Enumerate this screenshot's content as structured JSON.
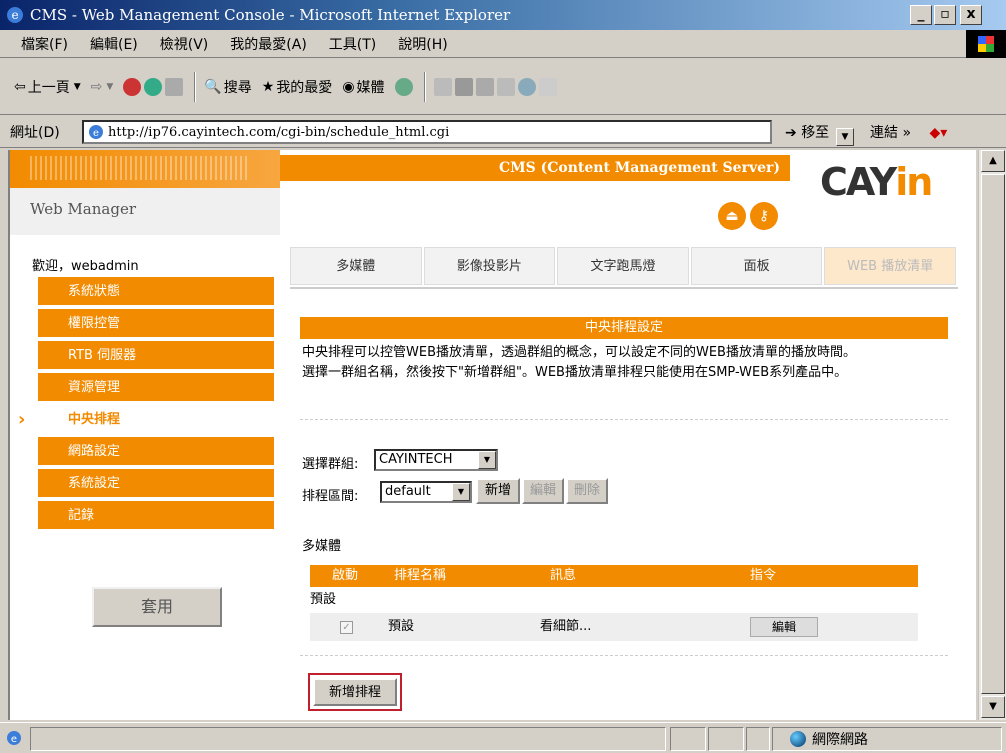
{
  "window": {
    "title": "CMS - Web Management Console - Microsoft Internet Explorer",
    "btn_min": "_",
    "btn_max": "▫",
    "btn_close": "x"
  },
  "menu": [
    "檔案(F)",
    "編輯(E)",
    "檢視(V)",
    "我的最愛(A)",
    "工具(T)",
    "說明(H)"
  ],
  "toolbar": {
    "back": "上一頁",
    "search": "搜尋",
    "favorites": "我的最愛",
    "media": "媒體"
  },
  "address": {
    "label": "網址(D)",
    "url": "http://ip76.cayintech.com/cgi-bin/schedule_html.cgi",
    "go": "移至",
    "links": "連結 »"
  },
  "header": {
    "product": "CMS (Content Management Server)",
    "web_manager": "Web Manager",
    "logo_main": "CAY",
    "logo_accent": "in"
  },
  "sidebar": {
    "welcome": "歡迎，webadmin",
    "items": [
      "系統狀態",
      "權限控管",
      "RTB 伺服器",
      "資源管理",
      "中央排程",
      "網路設定",
      "系統設定",
      "記錄"
    ],
    "active_index": 4,
    "apply": "套用"
  },
  "tabs": [
    "多媒體",
    "影像投影片",
    "文字跑馬燈",
    "面板",
    "WEB 播放清單"
  ],
  "active_tab": 4,
  "main": {
    "section_title": "中央排程設定",
    "desc_line1": "中央排程可以控管WEB播放清單，透過群組的概念，可以設定不同的WEB播放清單的播放時間。",
    "desc_line2": "選擇一群組名稱，然後按下\"新增群組\"。WEB播放清單排程只能使用在SMP-WEB系列產品中。",
    "group_label": "選擇群組:",
    "group_value": "CAYINTECH",
    "range_label": "排程區間:",
    "range_value": "default",
    "btn_new": "新增",
    "btn_edit": "編輯",
    "btn_delete": "刪除",
    "multimedia_label": "多媒體",
    "table_headers": [
      "啟動",
      "排程名稱",
      "訊息",
      "指令"
    ],
    "group_row": "預設",
    "row": {
      "name": "預設",
      "message": "看細節...",
      "action": "編輯",
      "enabled": true
    },
    "add_schedule": "新增排程"
  },
  "status": {
    "zone": "網際網路"
  }
}
